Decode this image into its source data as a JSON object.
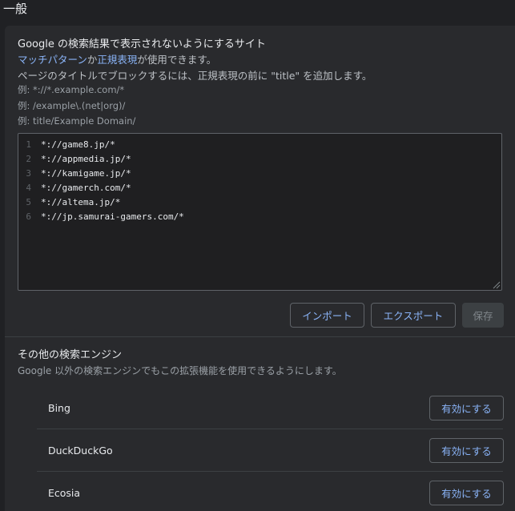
{
  "section": {
    "heading": "一般"
  },
  "blocklist": {
    "title": "Google の検索結果で表示されないようにするサイト",
    "desc_link1": "マッチパターン",
    "desc_mid": "か",
    "desc_link2": "正規表現",
    "desc_end": "が使用できます。",
    "title_hint": "ページのタイトルでブロックするには、正規表現の前に \"title\" を追加します。",
    "examples": [
      "例: *://*.example.com/*",
      "例: /example\\.(net|org)/",
      "例: title/Example Domain/"
    ],
    "editor_lines": [
      {
        "num": "1",
        "text": "*://game8.jp/*"
      },
      {
        "num": "2",
        "text": "*://appmedia.jp/*"
      },
      {
        "num": "3",
        "text": "*://kamigame.jp/*"
      },
      {
        "num": "4",
        "text": "*://gamerch.com/*"
      },
      {
        "num": "5",
        "text": "*://altema.jp/*"
      },
      {
        "num": "6",
        "text": "*://jp.samurai-gamers.com/*"
      }
    ],
    "import_label": "インポート",
    "export_label": "エクスポート",
    "save_label": "保存"
  },
  "engines": {
    "title": "その他の検索エンジン",
    "desc": "Google 以外の検索エンジンでもこの拡張機能を使用できるようにします。",
    "items": [
      {
        "name": "Bing",
        "action": "有効にする"
      },
      {
        "name": "DuckDuckGo",
        "action": "有効にする"
      },
      {
        "name": "Ecosia",
        "action": "有効にする"
      }
    ]
  }
}
